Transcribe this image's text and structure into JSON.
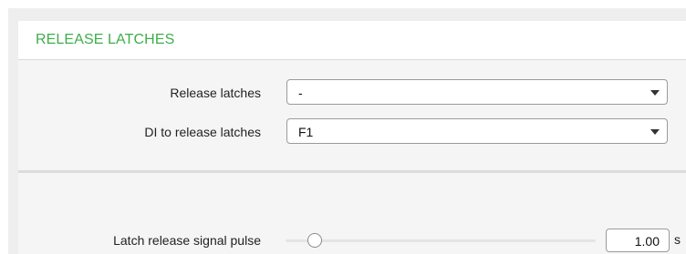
{
  "section": {
    "title": "RELEASE LATCHES"
  },
  "fields": {
    "release_latches": {
      "label": "Release latches",
      "value": "-"
    },
    "di_release": {
      "label": "DI to release latches",
      "value": "F1"
    },
    "pulse": {
      "label": "Latch release signal pulse",
      "value": "1.00",
      "unit": "s",
      "slider_fraction": 0.07
    }
  },
  "colors": {
    "accent": "#3dae4a"
  },
  "icons": {
    "dropdown": "chevron-down-icon"
  }
}
